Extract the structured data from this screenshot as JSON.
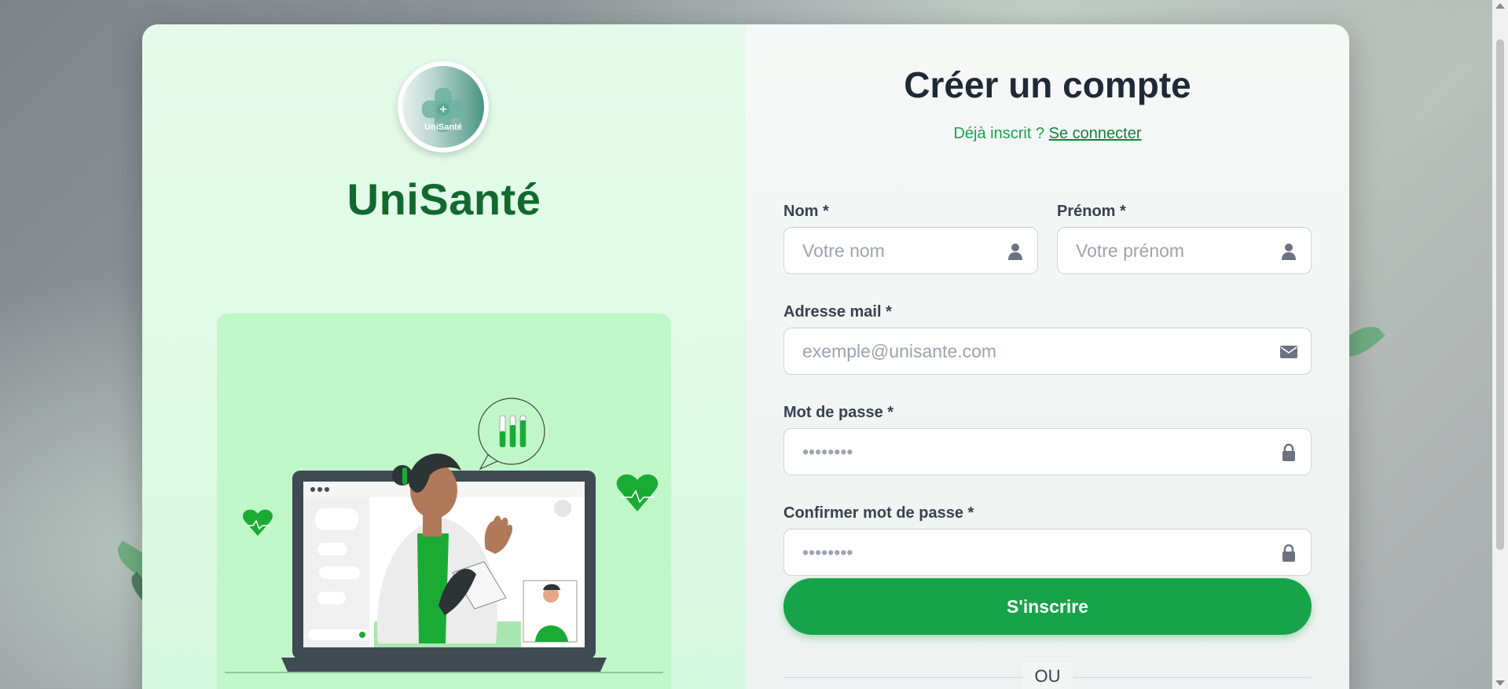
{
  "brand": {
    "logo_text": "UniSanté",
    "name": "UniSanté"
  },
  "form": {
    "title": "Créer un compte",
    "already_registered": "Déjà inscrit ?",
    "login_link": "Se connecter",
    "fields": {
      "last_name": {
        "label": "Nom *",
        "placeholder": "Votre nom",
        "icon": "user-icon"
      },
      "first_name": {
        "label": "Prénom *",
        "placeholder": "Votre prénom",
        "icon": "user-icon"
      },
      "email": {
        "label": "Adresse mail *",
        "placeholder": "exemple@unisante.com",
        "icon": "envelope-icon"
      },
      "password": {
        "label": "Mot de passe *",
        "placeholder": "••••••••",
        "icon": "lock-icon"
      },
      "confirm_password": {
        "label": "Confirmer mot de passe *",
        "placeholder": "••••••••",
        "icon": "lock-icon"
      }
    },
    "submit_label": "S'inscrire",
    "separator": "OU"
  },
  "colors": {
    "accent": "#16a34a",
    "brand_dark": "#12692f",
    "panel_left": "#d6f8df",
    "illustration_bg": "#c0f7c9"
  }
}
